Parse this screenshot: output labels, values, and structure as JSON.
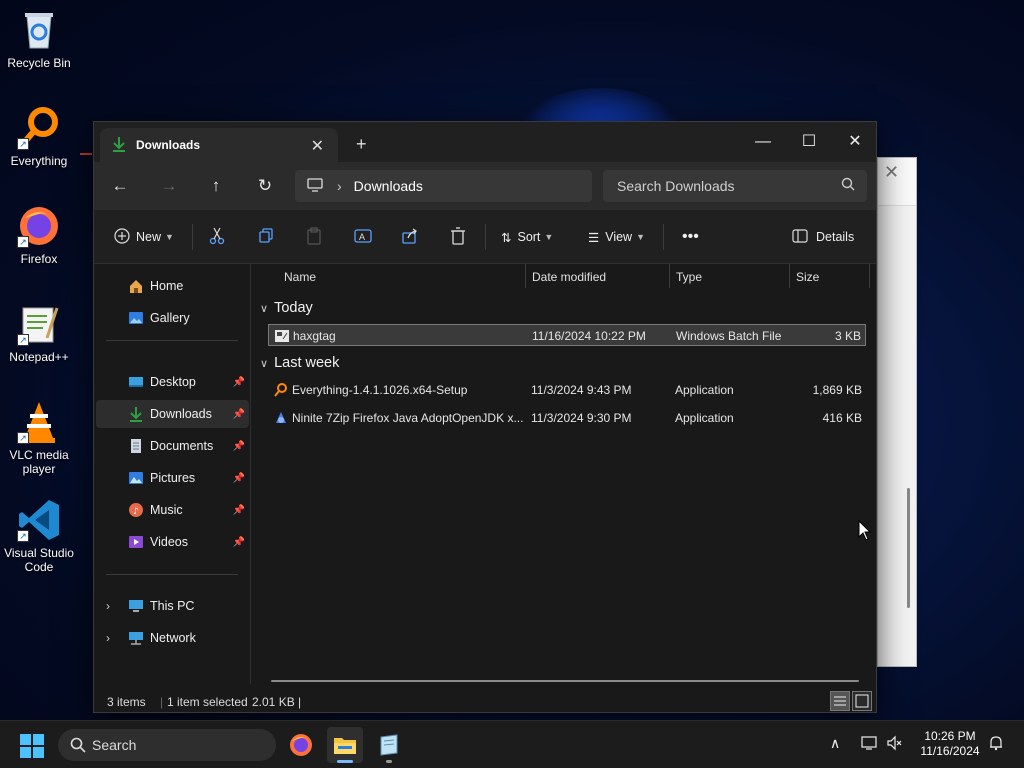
{
  "desktop": {
    "icons": [
      {
        "label": "Recycle Bin"
      },
      {
        "label": "Everything"
      },
      {
        "label": "Firefox"
      },
      {
        "label": "Notepad++"
      },
      {
        "label": "VLC media player"
      },
      {
        "label": "Visual Studio Code"
      }
    ]
  },
  "window": {
    "tab_title": "Downloads",
    "address": "Downloads",
    "search_placeholder": "Search Downloads",
    "toolbar": {
      "new_label": "New",
      "sort_label": "Sort",
      "view_label": "View",
      "details_label": "Details"
    },
    "sidebar": {
      "home": "Home",
      "gallery": "Gallery",
      "desktop": "Desktop",
      "downloads": "Downloads",
      "documents": "Documents",
      "pictures": "Pictures",
      "music": "Music",
      "videos": "Videos",
      "this_pc": "This PC",
      "network": "Network"
    },
    "columns": {
      "name": "Name",
      "date": "Date modified",
      "type": "Type",
      "size": "Size"
    },
    "groups": {
      "today": "Today",
      "last_week": "Last week"
    },
    "files": {
      "f1": {
        "name": "haxgtag",
        "date": "11/16/2024 10:22 PM",
        "type": "Windows Batch File",
        "size": "3 KB"
      },
      "f2": {
        "name": "Everything-1.4.1.1026.x64-Setup",
        "date": "11/3/2024 9:43 PM",
        "type": "Application",
        "size": "1,869 KB"
      },
      "f3": {
        "name": "Ninite 7Zip Firefox Java AdoptOpenJDK x...",
        "date": "11/3/2024 9:30 PM",
        "type": "Application",
        "size": "416 KB"
      }
    },
    "status": {
      "items": "3 items",
      "selected": "1 item selected",
      "selected_size": "2.01 KB",
      "cursor_bar": "|"
    }
  },
  "taskbar": {
    "search_label": "Search",
    "time": "10:26 PM",
    "date": "11/16/2024"
  }
}
